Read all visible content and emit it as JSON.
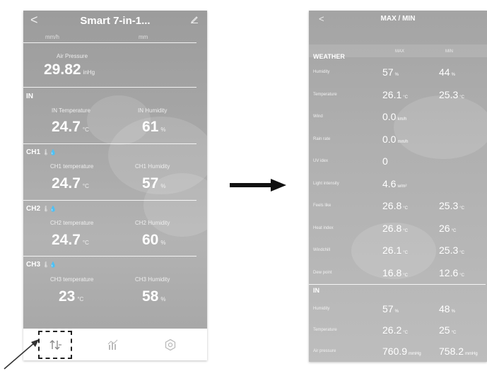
{
  "left_screen": {
    "header": {
      "back": "<",
      "title": "Smart 7-in-1...",
      "edit_icon": "pencil-icon"
    },
    "partial_row": {
      "v1": "",
      "u1": "mm/h",
      "v2": "",
      "u2": "mm"
    },
    "air_pressure": {
      "label": "Air Pressure",
      "value": "29.82",
      "unit": "inHg"
    },
    "sections": [
      {
        "title": "IN",
        "icon": "",
        "left": {
          "label": "IN Temperature",
          "value": "24.7",
          "unit": "°C"
        },
        "right": {
          "label": "IN Humidity",
          "value": "61",
          "unit": "%"
        }
      },
      {
        "title": "CH1",
        "icon": "🌡💧",
        "left": {
          "label": "CH1 temperature",
          "value": "24.7",
          "unit": "°C"
        },
        "right": {
          "label": "CH1 Humidity",
          "value": "57",
          "unit": "%"
        }
      },
      {
        "title": "CH2",
        "icon": "🌡💧",
        "left": {
          "label": "CH2 temperature",
          "value": "24.7",
          "unit": "°C"
        },
        "right": {
          "label": "CH2 Humidity",
          "value": "60",
          "unit": "%"
        }
      },
      {
        "title": "CH3",
        "icon": "🌡💧",
        "left": {
          "label": "CH3 temperature",
          "value": "23",
          "unit": "°C"
        },
        "right": {
          "label": "CH3 Humidity",
          "value": "58",
          "unit": "%"
        }
      }
    ],
    "nav": [
      "max-min-icon",
      "chart-icon",
      "settings-icon"
    ]
  },
  "right_screen": {
    "header": {
      "back": "<",
      "title": "MAX / MIN"
    },
    "col_max": "MAX",
    "col_min": "MIN",
    "weather_title": "WEATHER",
    "weather_rows": [
      {
        "label": "Humidity",
        "max": "57",
        "max_unit": "%",
        "min": "44",
        "min_unit": "%"
      },
      {
        "label": "Temperature",
        "max": "26.1",
        "max_unit": "°C",
        "min": "25.3",
        "min_unit": "°C"
      },
      {
        "label": "Wind",
        "max": "0.0",
        "max_unit": "km/h",
        "min": "",
        "min_unit": ""
      },
      {
        "label": "Rain rate",
        "max": "0.0",
        "max_unit": "mm/h",
        "min": "",
        "min_unit": ""
      },
      {
        "label": "UV idex",
        "max": "0",
        "max_unit": "",
        "min": "",
        "min_unit": ""
      },
      {
        "label": "Light intensity",
        "max": "4.6",
        "max_unit": "w/m²",
        "min": "",
        "min_unit": ""
      },
      {
        "label": "Feels like",
        "max": "26.8",
        "max_unit": "°C",
        "min": "25.3",
        "min_unit": "°C"
      },
      {
        "label": "Heat index",
        "max": "26.8",
        "max_unit": "°C",
        "min": "26",
        "min_unit": "°C"
      },
      {
        "label": "Windchill",
        "max": "26.1",
        "max_unit": "°C",
        "min": "25.3",
        "min_unit": "°C"
      },
      {
        "label": "Dew point",
        "max": "16.8",
        "max_unit": "°C",
        "min": "12.6",
        "min_unit": "°C"
      }
    ],
    "in_title": "IN",
    "in_rows": [
      {
        "label": "Humidity",
        "max": "57",
        "max_unit": "%",
        "min": "48",
        "min_unit": "%"
      },
      {
        "label": "Temperature",
        "max": "26.2",
        "max_unit": "°C",
        "min": "25",
        "min_unit": "°C"
      },
      {
        "label": "Air pressure",
        "max": "760.9",
        "max_unit": "mmHg",
        "min": "758.2",
        "min_unit": "mmHg"
      }
    ]
  }
}
